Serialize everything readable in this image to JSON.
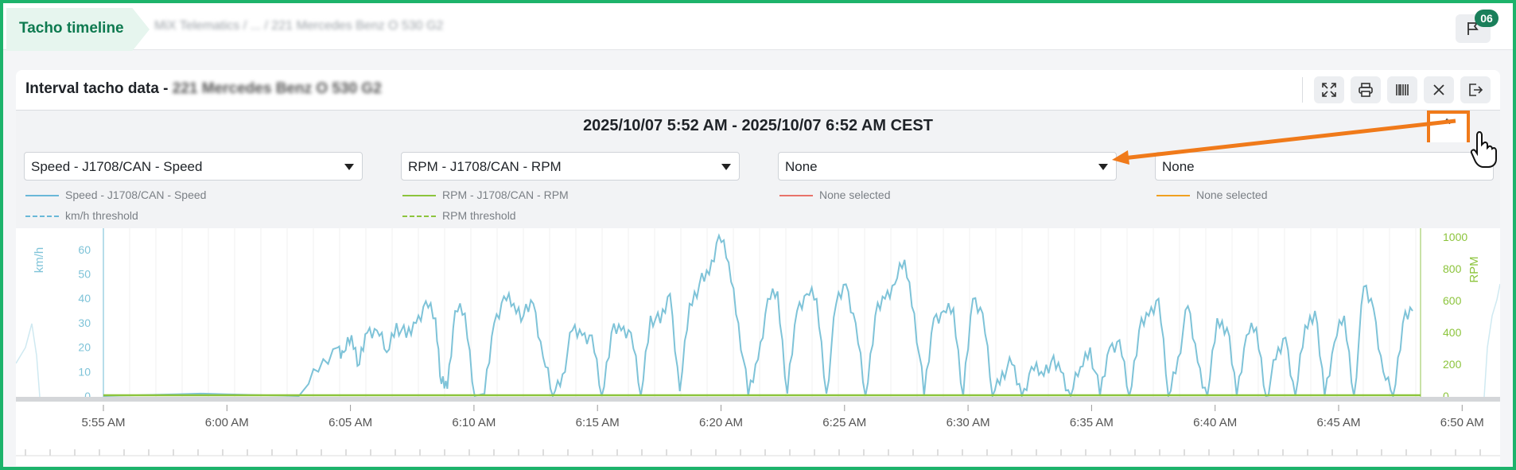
{
  "header": {
    "tab_title": "Tacho timeline",
    "breadcrumb": "MiX Telematics / ... / 221 Mercedes Benz O 530 G2",
    "notification_count": "06"
  },
  "panel": {
    "title_prefix": "Interval tacho data - ",
    "title_vehicle": "221 Mercedes Benz O 530 G2",
    "toolbar": [
      "expand-icon",
      "print-icon",
      "barcode-icon",
      "close-icon",
      "exit-icon"
    ]
  },
  "range": {
    "text": "2025/10/07 5:52 AM  -  2025/10/07 6:52 AM CEST",
    "collapse_glyph": "^"
  },
  "selectors": [
    {
      "value": "Speed - J1708/CAN - Speed",
      "legend": [
        "Speed - J1708/CAN - Speed",
        "km/h threshold"
      ],
      "color": "#6ab8d8"
    },
    {
      "value": "RPM - J1708/CAN - RPM",
      "legend": [
        "RPM - J1708/CAN - RPM",
        "RPM threshold"
      ],
      "color": "#8cc43c"
    },
    {
      "value": "None",
      "legend": [
        "None selected"
      ],
      "color": "#e8726a"
    },
    {
      "value": "None",
      "legend": [
        "None selected"
      ],
      "color": "#f0a020"
    }
  ],
  "chart_data": {
    "type": "line",
    "left_axis": {
      "label": "km/h",
      "ticks": [
        "0",
        "10",
        "20",
        "30",
        "40",
        "50",
        "60"
      ]
    },
    "right_axis": {
      "label": "RPM",
      "ticks": [
        "0",
        "200",
        "400",
        "600",
        "800",
        "1000"
      ]
    },
    "x_ticks": [
      "5:55 AM",
      "6:00 AM",
      "6:05 AM",
      "6:10 AM",
      "6:15 AM",
      "6:20 AM",
      "6:25 AM",
      "6:30 AM",
      "6:35 AM",
      "6:40 AM",
      "6:45 AM",
      "6:50 AM"
    ],
    "series": [
      {
        "name": "Speed - J1708/CAN - Speed",
        "color": "#7ec3d8",
        "points": [
          [
            0,
            0
          ],
          [
            5,
            1
          ],
          [
            10,
            0
          ],
          [
            11,
            10
          ],
          [
            12,
            20
          ],
          [
            12.3,
            18
          ],
          [
            12.7,
            25
          ],
          [
            13.1,
            13
          ],
          [
            13.5,
            26
          ],
          [
            14,
            27
          ],
          [
            14.5,
            18
          ],
          [
            15,
            30
          ],
          [
            15.5,
            24
          ],
          [
            16,
            30
          ],
          [
            16.5,
            39
          ],
          [
            17,
            32
          ],
          [
            17.3,
            5
          ],
          [
            17.6,
            3
          ],
          [
            18,
            35
          ],
          [
            18.5,
            34
          ],
          [
            19,
            0
          ],
          [
            19.5,
            1
          ],
          [
            20,
            30
          ],
          [
            20.5,
            41
          ],
          [
            21,
            38
          ],
          [
            21.5,
            33
          ],
          [
            22,
            38
          ],
          [
            22.5,
            16
          ],
          [
            23,
            0
          ],
          [
            23.5,
            9
          ],
          [
            24,
            27
          ],
          [
            24.5,
            25
          ],
          [
            25,
            25
          ],
          [
            25.5,
            0
          ],
          [
            26,
            26
          ],
          [
            26.5,
            27
          ],
          [
            27,
            26
          ],
          [
            27.5,
            0
          ],
          [
            28,
            33
          ],
          [
            28.5,
            30
          ],
          [
            29,
            42
          ],
          [
            29.5,
            2
          ],
          [
            30,
            38
          ],
          [
            30.5,
            46
          ],
          [
            31,
            50
          ],
          [
            31.5,
            66
          ],
          [
            32,
            55
          ],
          [
            32.5,
            30
          ],
          [
            33,
            0
          ],
          [
            33.5,
            15
          ],
          [
            34,
            40
          ],
          [
            34.5,
            43
          ],
          [
            35,
            1
          ],
          [
            35.5,
            35
          ],
          [
            36,
            42
          ],
          [
            36.5,
            40
          ],
          [
            37,
            1
          ],
          [
            37.5,
            38
          ],
          [
            38,
            46
          ],
          [
            38.5,
            30
          ],
          [
            39,
            0
          ],
          [
            39.5,
            33
          ],
          [
            40,
            40
          ],
          [
            40.5,
            46
          ],
          [
            41,
            56
          ],
          [
            41.5,
            34
          ],
          [
            42,
            0
          ],
          [
            42.5,
            32
          ],
          [
            43,
            35
          ],
          [
            43.5,
            36
          ],
          [
            44,
            0
          ],
          [
            44.5,
            40
          ],
          [
            45,
            34
          ],
          [
            45.5,
            0
          ],
          [
            46,
            10
          ],
          [
            46.5,
            13
          ],
          [
            47,
            0
          ],
          [
            47.5,
            12
          ],
          [
            48,
            10
          ],
          [
            48.5,
            14
          ],
          [
            49,
            10
          ],
          [
            49.5,
            0
          ],
          [
            50,
            12
          ],
          [
            50.5,
            20
          ],
          [
            51,
            0
          ],
          [
            51.5,
            20
          ],
          [
            52,
            23
          ],
          [
            52.5,
            0
          ],
          [
            53,
            27
          ],
          [
            53.5,
            33
          ],
          [
            54,
            40
          ],
          [
            54.5,
            0
          ],
          [
            55,
            16
          ],
          [
            55.5,
            37
          ],
          [
            56,
            14
          ],
          [
            56.5,
            0
          ],
          [
            57,
            32
          ],
          [
            57.5,
            28
          ],
          [
            58,
            0
          ],
          [
            58.5,
            25
          ],
          [
            59,
            28
          ],
          [
            59.5,
            0
          ],
          [
            60,
            15
          ],
          [
            60.5,
            24
          ],
          [
            61,
            0
          ],
          [
            61.5,
            29
          ],
          [
            62,
            35
          ],
          [
            62.5,
            0
          ],
          [
            63,
            22
          ],
          [
            63.5,
            33
          ],
          [
            64,
            0
          ],
          [
            64.5,
            45
          ],
          [
            65,
            36
          ],
          [
            65.5,
            10
          ],
          [
            66,
            0
          ],
          [
            66.5,
            30
          ],
          [
            67,
            35
          ]
        ]
      },
      {
        "name": "RPM - J1708/CAN - RPM",
        "color": "#8cc43c",
        "points": [
          [
            0,
            0
          ],
          [
            67,
            0
          ]
        ]
      }
    ]
  }
}
